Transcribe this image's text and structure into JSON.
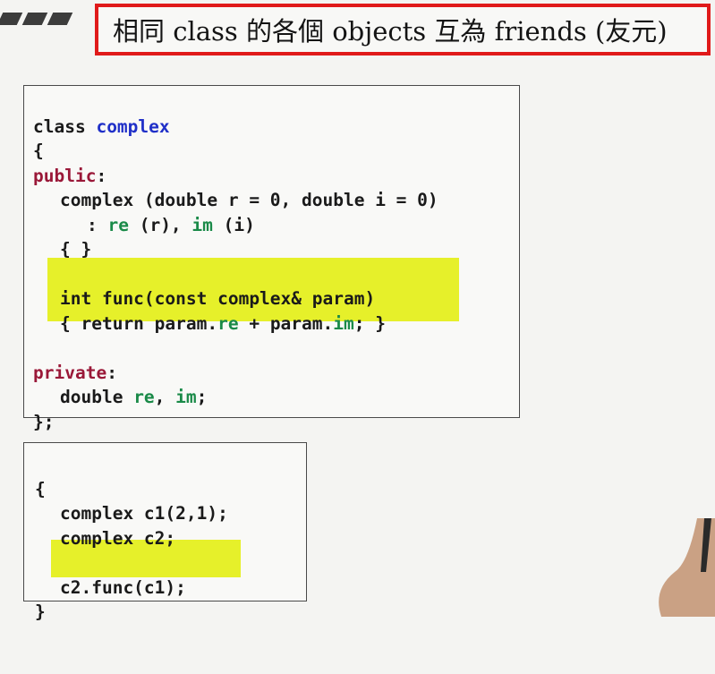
{
  "title": "相同 class 的各個 objects 互為 friends (友元)",
  "class_box": {
    "line1_kw": "class",
    "line1_name": "complex",
    "line2": "{",
    "line3_access": "public",
    "line3_colon": ":",
    "line4": "complex (double r = 0, double i = 0)",
    "line5_a": ": ",
    "line5_re": "re",
    "line5_b": " (r), ",
    "line5_im": "im",
    "line5_c": " (i)",
    "line6": "{ }",
    "line8": "int func(const complex& param)",
    "line9_a": "{ return param.",
    "line9_re": "re",
    "line9_b": " + param.",
    "line9_im": "im",
    "line9_c": "; }",
    "line11_access": "private",
    "line11_colon": ":",
    "line12_a": "double ",
    "line12_re": "re",
    "line12_b": ", ",
    "line12_im": "im",
    "line12_c": ";",
    "line13": "};"
  },
  "main_box": {
    "line1": "{",
    "line2": "complex c1(2,1);",
    "line3": "complex c2;",
    "line5": "c2.func(c1);",
    "line6": "}"
  },
  "colors": {
    "title_border": "#e01a1a",
    "keyword_blue": "#2030c8",
    "access_maroon": "#9a1838",
    "member_green": "#1a8a48",
    "highlight": "#e6f02a"
  }
}
